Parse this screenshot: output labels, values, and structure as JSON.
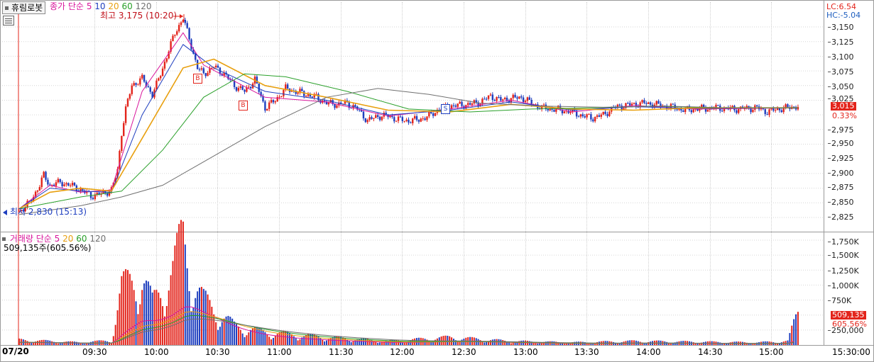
{
  "window": {
    "stock_name": "휴림로봇",
    "date_label": "07/20",
    "colors": {
      "up": "#e3241b",
      "down": "#1f3fbf",
      "ma5": "#d9169c",
      "ma10": "#1f3fbf",
      "ma20": "#e8a010",
      "ma60": "#2aa02a",
      "ma120": "#707070",
      "accent": "#e3241b"
    }
  },
  "price_legend": {
    "label": "종가 단순",
    "periods": [
      "5",
      "10",
      "20",
      "60",
      "120"
    ]
  },
  "price_annotations": {
    "high_label": "최고 3,175 (10:20)",
    "low_label": "최저 2,830 (15:13)",
    "lc_label": "LC:6.54",
    "hc_label": "HC:-5.04",
    "buy_marker": "B",
    "sell_marker": "S"
  },
  "price_axis": {
    "ticks": [
      "3,150",
      "3,125",
      "3,100",
      "3,075",
      "3,050",
      "3,025",
      "2,975",
      "2,950",
      "2,925",
      "2,900",
      "2,875",
      "2,850",
      "2,825"
    ],
    "current_price": "3,015",
    "current_change": "0.33%"
  },
  "volume_legend": {
    "label": "거래량 단순",
    "periods": [
      "5",
      "20",
      "60",
      "120"
    ],
    "current": "509,135주(605.56%)"
  },
  "volume_axis": {
    "ticks": [
      "1,750K",
      "1,500K",
      "1,250K",
      "1,000K",
      "750K",
      "500K",
      "250,000"
    ],
    "current_volume": "509,135",
    "current_ratio": "605.56%"
  },
  "time_axis": {
    "ticks": [
      "09:30",
      "10:00",
      "10:30",
      "11:00",
      "11:30",
      "12:00",
      "12:30",
      "13:00",
      "13:30",
      "14:00",
      "14:30",
      "15:00"
    ],
    "end_label": "15:30:00"
  },
  "chart_data": {
    "type": "candlestick",
    "price_unit": "KRW",
    "price_range": [
      2812,
      3175
    ],
    "volume_range": [
      0,
      1800000
    ],
    "time_range": [
      "09:00",
      "15:30"
    ],
    "price_path": [
      [
        "09:00",
        2835
      ],
      [
        "09:05",
        2850
      ],
      [
        "09:10",
        2880
      ],
      [
        "09:12",
        2897
      ],
      [
        "09:15",
        2880
      ],
      [
        "09:20",
        2885
      ],
      [
        "09:25",
        2880
      ],
      [
        "09:30",
        2872
      ],
      [
        "09:35",
        2862
      ],
      [
        "09:40",
        2865
      ],
      [
        "09:45",
        2872
      ],
      [
        "09:48",
        2905
      ],
      [
        "09:50",
        2970
      ],
      [
        "09:52",
        3010
      ],
      [
        "09:55",
        3050
      ],
      [
        "10:00",
        3062
      ],
      [
        "10:05",
        3035
      ],
      [
        "10:08",
        3060
      ],
      [
        "10:12",
        3100
      ],
      [
        "10:16",
        3140
      ],
      [
        "10:20",
        3165
      ],
      [
        "10:23",
        3130
      ],
      [
        "10:27",
        3080
      ],
      [
        "10:30",
        3070
      ],
      [
        "10:35",
        3082
      ],
      [
        "10:40",
        3070
      ],
      [
        "10:45",
        3050
      ],
      [
        "10:50",
        3040
      ],
      [
        "10:55",
        3060
      ],
      [
        "11:00",
        3012
      ],
      [
        "11:05",
        3025
      ],
      [
        "11:10",
        3045
      ],
      [
        "11:15",
        3040
      ],
      [
        "11:20",
        3035
      ],
      [
        "11:25",
        3030
      ],
      [
        "11:30",
        3020
      ],
      [
        "11:35",
        3018
      ],
      [
        "11:40",
        3020
      ],
      [
        "11:45",
        3010
      ],
      [
        "11:50",
        2990
      ],
      [
        "11:55",
        2998
      ],
      [
        "12:00",
        2998
      ],
      [
        "12:05",
        2992
      ],
      [
        "12:10",
        2990
      ],
      [
        "12:15",
        2992
      ],
      [
        "12:20",
        2998
      ],
      [
        "12:25",
        3010
      ],
      [
        "12:30",
        3015
      ],
      [
        "12:40",
        3018
      ],
      [
        "12:45",
        3022
      ],
      [
        "12:50",
        3032
      ],
      [
        "12:55",
        3025
      ],
      [
        "13:00",
        3028
      ],
      [
        "13:05",
        3030
      ],
      [
        "13:10",
        3020
      ],
      [
        "13:15",
        3012
      ],
      [
        "13:20",
        3010
      ],
      [
        "13:30",
        3005
      ],
      [
        "13:35",
        2998
      ],
      [
        "13:40",
        2995
      ],
      [
        "13:45",
        3000
      ],
      [
        "13:50",
        3012
      ],
      [
        "13:55",
        3016
      ],
      [
        "14:00",
        3018
      ],
      [
        "14:05",
        3020
      ],
      [
        "14:10",
        3018
      ],
      [
        "14:15",
        3015
      ],
      [
        "14:20",
        3012
      ],
      [
        "14:25",
        3008
      ],
      [
        "14:30",
        3010
      ],
      [
        "14:40",
        3012
      ],
      [
        "14:50",
        3010
      ],
      [
        "15:00",
        3012
      ],
      [
        "15:05",
        3005
      ],
      [
        "15:10",
        3010
      ],
      [
        "15:15",
        3012
      ],
      [
        "15:20",
        3015
      ]
    ],
    "ma_series": [
      {
        "period": "5",
        "values": [
          [
            "09:00",
            2840
          ],
          [
            "09:15",
            2880
          ],
          [
            "09:30",
            2868
          ],
          [
            "09:45",
            2872
          ],
          [
            "10:00",
            3040
          ],
          [
            "10:20",
            3140
          ],
          [
            "10:30",
            3085
          ],
          [
            "11:00",
            3030
          ],
          [
            "11:30",
            3022
          ],
          [
            "12:00",
            2998
          ],
          [
            "12:30",
            3010
          ],
          [
            "13:00",
            3025
          ],
          [
            "13:30",
            3005
          ],
          [
            "14:00",
            3016
          ],
          [
            "14:30",
            3010
          ],
          [
            "15:20",
            3012
          ]
        ]
      },
      {
        "period": "10",
        "values": [
          [
            "09:00",
            2840
          ],
          [
            "09:15",
            2875
          ],
          [
            "09:30",
            2870
          ],
          [
            "09:45",
            2868
          ],
          [
            "10:00",
            3000
          ],
          [
            "10:20",
            3120
          ],
          [
            "10:35",
            3080
          ],
          [
            "11:00",
            3040
          ],
          [
            "11:30",
            3025
          ],
          [
            "12:00",
            3000
          ],
          [
            "12:30",
            3008
          ],
          [
            "13:00",
            3022
          ],
          [
            "13:30",
            3008
          ],
          [
            "14:00",
            3014
          ],
          [
            "14:30",
            3011
          ],
          [
            "15:20",
            3012
          ]
        ]
      },
      {
        "period": "20",
        "values": [
          [
            "09:00",
            2840
          ],
          [
            "09:15",
            2868
          ],
          [
            "09:30",
            2875
          ],
          [
            "09:45",
            2870
          ],
          [
            "10:00",
            2960
          ],
          [
            "10:20",
            3080
          ],
          [
            "10:35",
            3095
          ],
          [
            "11:00",
            3050
          ],
          [
            "11:30",
            3030
          ],
          [
            "12:00",
            3008
          ],
          [
            "12:30",
            3005
          ],
          [
            "13:00",
            3018
          ],
          [
            "13:30",
            3010
          ],
          [
            "14:00",
            3008
          ],
          [
            "14:30",
            3012
          ],
          [
            "15:20",
            3012
          ]
        ]
      },
      {
        "period": "60",
        "values": [
          [
            "09:00",
            2840
          ],
          [
            "09:30",
            2860
          ],
          [
            "09:50",
            2870
          ],
          [
            "10:10",
            2940
          ],
          [
            "10:30",
            3030
          ],
          [
            "10:50",
            3070
          ],
          [
            "11:10",
            3065
          ],
          [
            "11:40",
            3040
          ],
          [
            "12:10",
            3010
          ],
          [
            "12:40",
            3005
          ],
          [
            "13:10",
            3010
          ],
          [
            "13:40",
            3012
          ],
          [
            "14:10",
            3015
          ],
          [
            "14:40",
            3012
          ],
          [
            "15:20",
            3012
          ]
        ]
      },
      {
        "period": "120",
        "values": [
          [
            "09:00",
            2830
          ],
          [
            "09:30",
            2845
          ],
          [
            "09:50",
            2860
          ],
          [
            "10:10",
            2880
          ],
          [
            "10:30",
            2920
          ],
          [
            "11:00",
            2980
          ],
          [
            "11:30",
            3030
          ],
          [
            "11:55",
            3045
          ],
          [
            "12:20",
            3035
          ],
          [
            "12:45",
            3020
          ],
          [
            "13:15",
            3015
          ],
          [
            "13:45",
            3013
          ],
          [
            "14:15",
            3015
          ],
          [
            "14:45",
            3012
          ],
          [
            "15:20",
            3012
          ]
        ]
      }
    ],
    "volume_profile": [
      [
        "09:00",
        80000
      ],
      [
        "09:30",
        40000
      ],
      [
        "09:45",
        70000
      ],
      [
        "09:50",
        900000
      ],
      [
        "10:00",
        1100000
      ],
      [
        "10:05",
        650000
      ],
      [
        "10:15",
        1200000
      ],
      [
        "10:20",
        1700000
      ],
      [
        "10:25",
        1000000
      ],
      [
        "10:30",
        700000
      ],
      [
        "10:45",
        300000
      ],
      [
        "11:00",
        200000
      ],
      [
        "11:30",
        120000
      ],
      [
        "12:00",
        60000
      ],
      [
        "12:30",
        120000
      ],
      [
        "13:00",
        60000
      ],
      [
        "13:30",
        40000
      ],
      [
        "14:00",
        60000
      ],
      [
        "14:30",
        50000
      ],
      [
        "15:00",
        40000
      ],
      [
        "15:15",
        60000
      ],
      [
        "15:20",
        509135
      ]
    ]
  }
}
